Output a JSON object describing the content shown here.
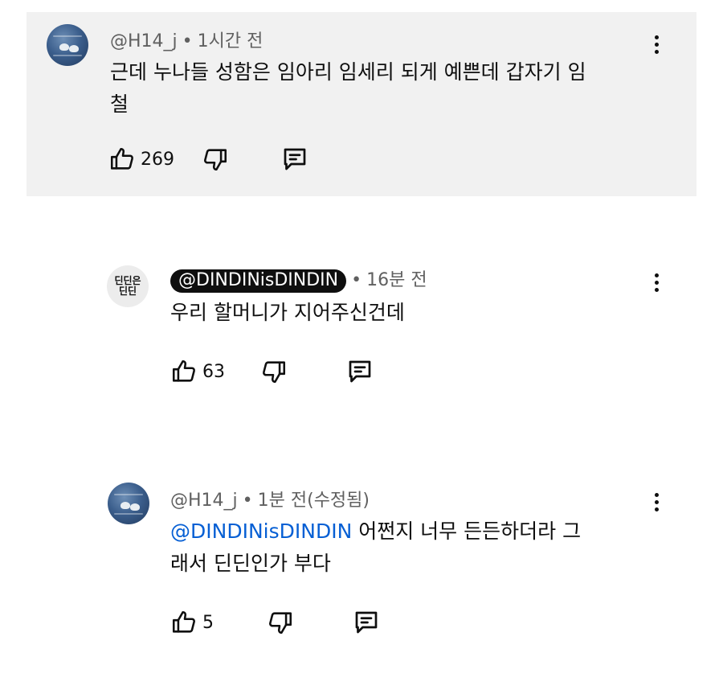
{
  "comments": [
    {
      "handle": "@H14_j",
      "separator": "•",
      "time": "1시간 전",
      "text_line1": "근데 누나들 성함은 임아리 임세리 되게 예쁜데 갑자기 임",
      "text_line2": "철",
      "likes": "269",
      "avatar_icon": "water-birds-avatar"
    },
    {
      "handle": "@DINDINisDINDIN",
      "separator": "•",
      "time": "16분 전",
      "text": "우리 할머니가 지어주신건데",
      "likes": "63",
      "avatar_line1": "딘딘은",
      "avatar_line2": "딘딘"
    },
    {
      "handle": "@H14_j",
      "separator": "•",
      "time": "1분 전(수정됨)",
      "mention": "@DINDINisDINDIN",
      "text_line1_rest": " 어쩐지 너무 든든하더라 그",
      "text_line2": "래서 딘딘인가 부다",
      "likes": "5",
      "avatar_icon": "water-birds-avatar"
    }
  ],
  "icons": {
    "like": "thumbs-up-icon",
    "dislike": "thumbs-down-icon",
    "reply": "reply-icon",
    "more": "more-vertical-icon"
  },
  "colors": {
    "highlight_bg": "#f1f1f1",
    "mention": "#065fd4",
    "creator_badge_bg": "#0f0f0f"
  }
}
